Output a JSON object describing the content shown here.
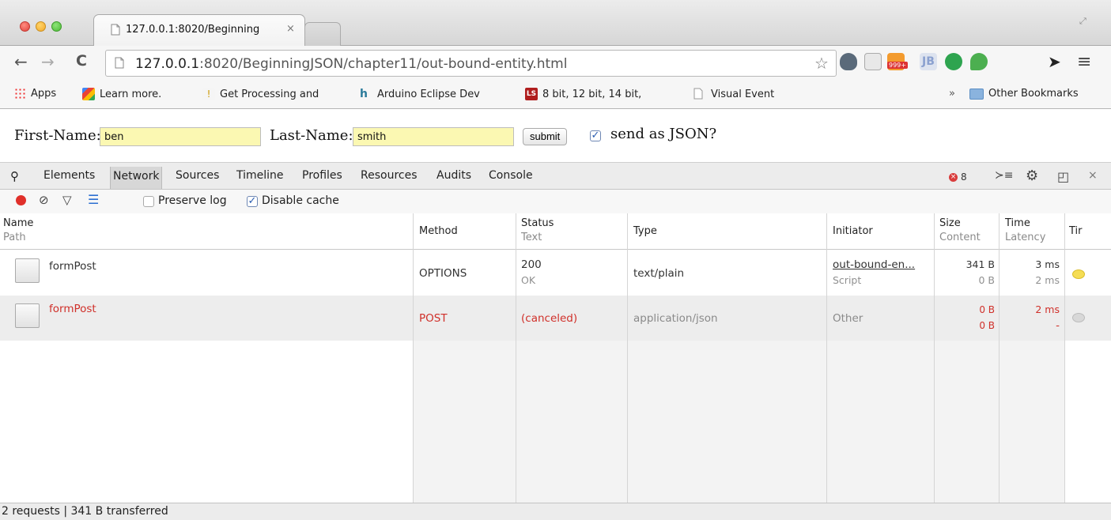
{
  "window": {
    "tab_title": "127.0.0.1:8020/Beginning",
    "tab_close": "×"
  },
  "toolbar": {
    "url_host": "127.0.0.1",
    "url_rest": ":8020/BeginningJSON/chapter11/out-bound-entity.html",
    "back": "←",
    "forward": "→",
    "reload": "C",
    "star": "☆",
    "menu": "≡",
    "rss_badge": "999+"
  },
  "bookmarks": [
    {
      "label": "Apps"
    },
    {
      "label": "Learn more."
    },
    {
      "label": "Get Processing and"
    },
    {
      "label": "Arduino Eclipse Dev"
    },
    {
      "label": "8 bit, 12 bit, 14 bit,"
    },
    {
      "label": "Visual Event"
    }
  ],
  "bookmarks_overflow": "»",
  "bookmarks_other": "Other Bookmarks",
  "form": {
    "first_label": "First-Name:",
    "first_value": "ben",
    "last_label": "Last-Name:",
    "last_value": "smith",
    "submit": "submit",
    "json_checked": true,
    "json_label": "send as JSON?"
  },
  "devtools": {
    "tabs": [
      "Elements",
      "Network",
      "Sources",
      "Timeline",
      "Profiles",
      "Resources",
      "Audits",
      "Console"
    ],
    "active_tab": "Network",
    "error_count": "8",
    "close": "×"
  },
  "network": {
    "preserve_log": "Preserve log",
    "preserve_checked": false,
    "disable_cache": "Disable cache",
    "disable_checked": true,
    "headers": {
      "name": "Name",
      "name_sub": "Path",
      "method": "Method",
      "status": "Status",
      "status_sub": "Text",
      "type": "Type",
      "initiator": "Initiator",
      "size": "Size",
      "size_sub": "Content",
      "time": "Time",
      "time_sub": "Latency",
      "timeline": "Tir"
    },
    "rows": [
      {
        "name": "formPost",
        "method": "OPTIONS",
        "status": "200",
        "status_text": "OK",
        "type": "text/plain",
        "initiator": "out-bound-en...",
        "initiator_sub": "Script",
        "size": "341 B",
        "content": "0 B",
        "time": "3 ms",
        "latency": "2 ms",
        "dot_color": "#f5dd55"
      },
      {
        "name": "formPost",
        "method": "POST",
        "status": "(canceled)",
        "status_text": "",
        "type": "application/json",
        "initiator": "Other",
        "initiator_sub": "",
        "size": "0 B",
        "content": "0 B",
        "time": "2 ms",
        "latency": "-",
        "dot_color": "#d8d8d8"
      }
    ],
    "summary": "2 requests | 341 B transferred"
  }
}
